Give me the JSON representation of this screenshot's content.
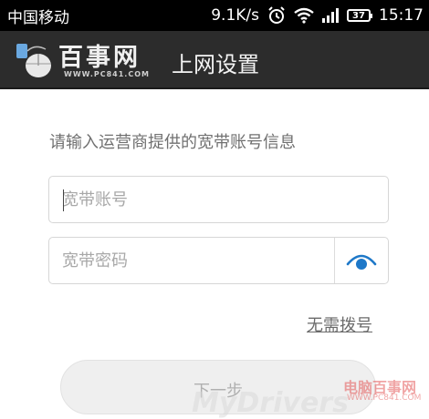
{
  "status_bar": {
    "carrier": "中国移动",
    "speed": "9.1K/s",
    "battery": "37",
    "time": "15:17"
  },
  "header": {
    "logo_text": "百事网",
    "logo_subtext": "WWW.PC841.COM",
    "title": "上网设置"
  },
  "form": {
    "prompt": "请输入运营商提供的宽带账号信息",
    "account_placeholder": "宽带账号",
    "password_placeholder": "宽带密码",
    "no_dial_link": "无需拨号",
    "next_button": "下一步"
  },
  "watermark": {
    "brand": "电脑百事网",
    "site": "WWW.PC841.COM",
    "main": "MyDrivers"
  },
  "colors": {
    "header_bg": "#2c2c2c",
    "eye_icon": "#1e78c8"
  }
}
